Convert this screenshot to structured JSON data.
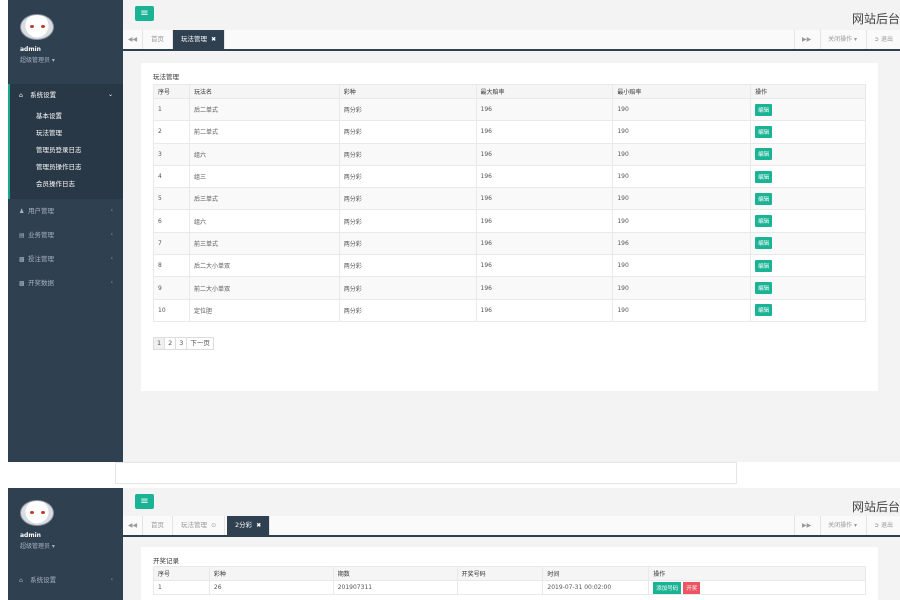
{
  "frame1": {
    "user": {
      "name": "admin",
      "role": "超级管理员 ▾"
    },
    "menu": {
      "active": {
        "label": "系统设置",
        "icon": "home-icon"
      },
      "sub_items": [
        "基本设置",
        "玩法管理",
        "管理员登录日志",
        "管理员操作日志",
        "会员操作日志"
      ],
      "items": [
        {
          "label": "用户管理",
          "icon": "user-icon"
        },
        {
          "label": "业务管理",
          "icon": "document-icon"
        },
        {
          "label": "投注管理",
          "icon": "bar-chart-icon"
        },
        {
          "label": "开奖数据",
          "icon": "bar-chart-icon"
        }
      ]
    },
    "site_title": "网站后台",
    "tabs": {
      "home": "首页",
      "active": "玩法管理"
    },
    "tab_right": {
      "close_ops": "关闭操作 ▾",
      "logout": "退出"
    },
    "panel_title": "玩法管理",
    "table": {
      "headers": [
        "序号",
        "玩法名",
        "彩种",
        "最大赔率",
        "最小赔率",
        "操作"
      ],
      "rows": [
        [
          "1",
          "后二单式",
          "两分彩",
          "196",
          "190",
          "编辑"
        ],
        [
          "2",
          "前二单式",
          "两分彩",
          "196",
          "190",
          "编辑"
        ],
        [
          "3",
          "组六",
          "两分彩",
          "196",
          "190",
          "编辑"
        ],
        [
          "4",
          "组三",
          "两分彩",
          "196",
          "190",
          "编辑"
        ],
        [
          "5",
          "后三单式",
          "两分彩",
          "196",
          "190",
          "编辑"
        ],
        [
          "6",
          "组六",
          "两分彩",
          "196",
          "190",
          "编辑"
        ],
        [
          "7",
          "前三单式",
          "两分彩",
          "196",
          "196",
          "编辑"
        ],
        [
          "8",
          "后二大小单双",
          "两分彩",
          "196",
          "190",
          "编辑"
        ],
        [
          "9",
          "前二大小单双",
          "两分彩",
          "196",
          "190",
          "编辑"
        ],
        [
          "10",
          "定位胆",
          "两分彩",
          "196",
          "190",
          "编辑"
        ]
      ]
    },
    "pager": [
      "1",
      "2",
      "3",
      "下一页"
    ]
  },
  "frame2": {
    "user": {
      "name": "admin",
      "role": "超级管理员 ▾"
    },
    "menu_active": "系统设置",
    "site_title": "网站后台",
    "tabs": {
      "home": "首页",
      "play": "玩法管理",
      "active": "2分彩"
    },
    "tab_right": {
      "close_ops": "关闭操作 ▾",
      "logout": "退出"
    },
    "panel_title": "开奖记录",
    "table": {
      "headers": [
        "序号",
        "彩种",
        "期数",
        "开奖号码",
        "时间",
        "操作"
      ],
      "rows": [
        {
          "cells": [
            "1",
            "26",
            "201907311",
            "",
            "2019-07-31 00:02:00"
          ],
          "actions": [
            "添加号码",
            "开奖"
          ]
        }
      ]
    }
  }
}
